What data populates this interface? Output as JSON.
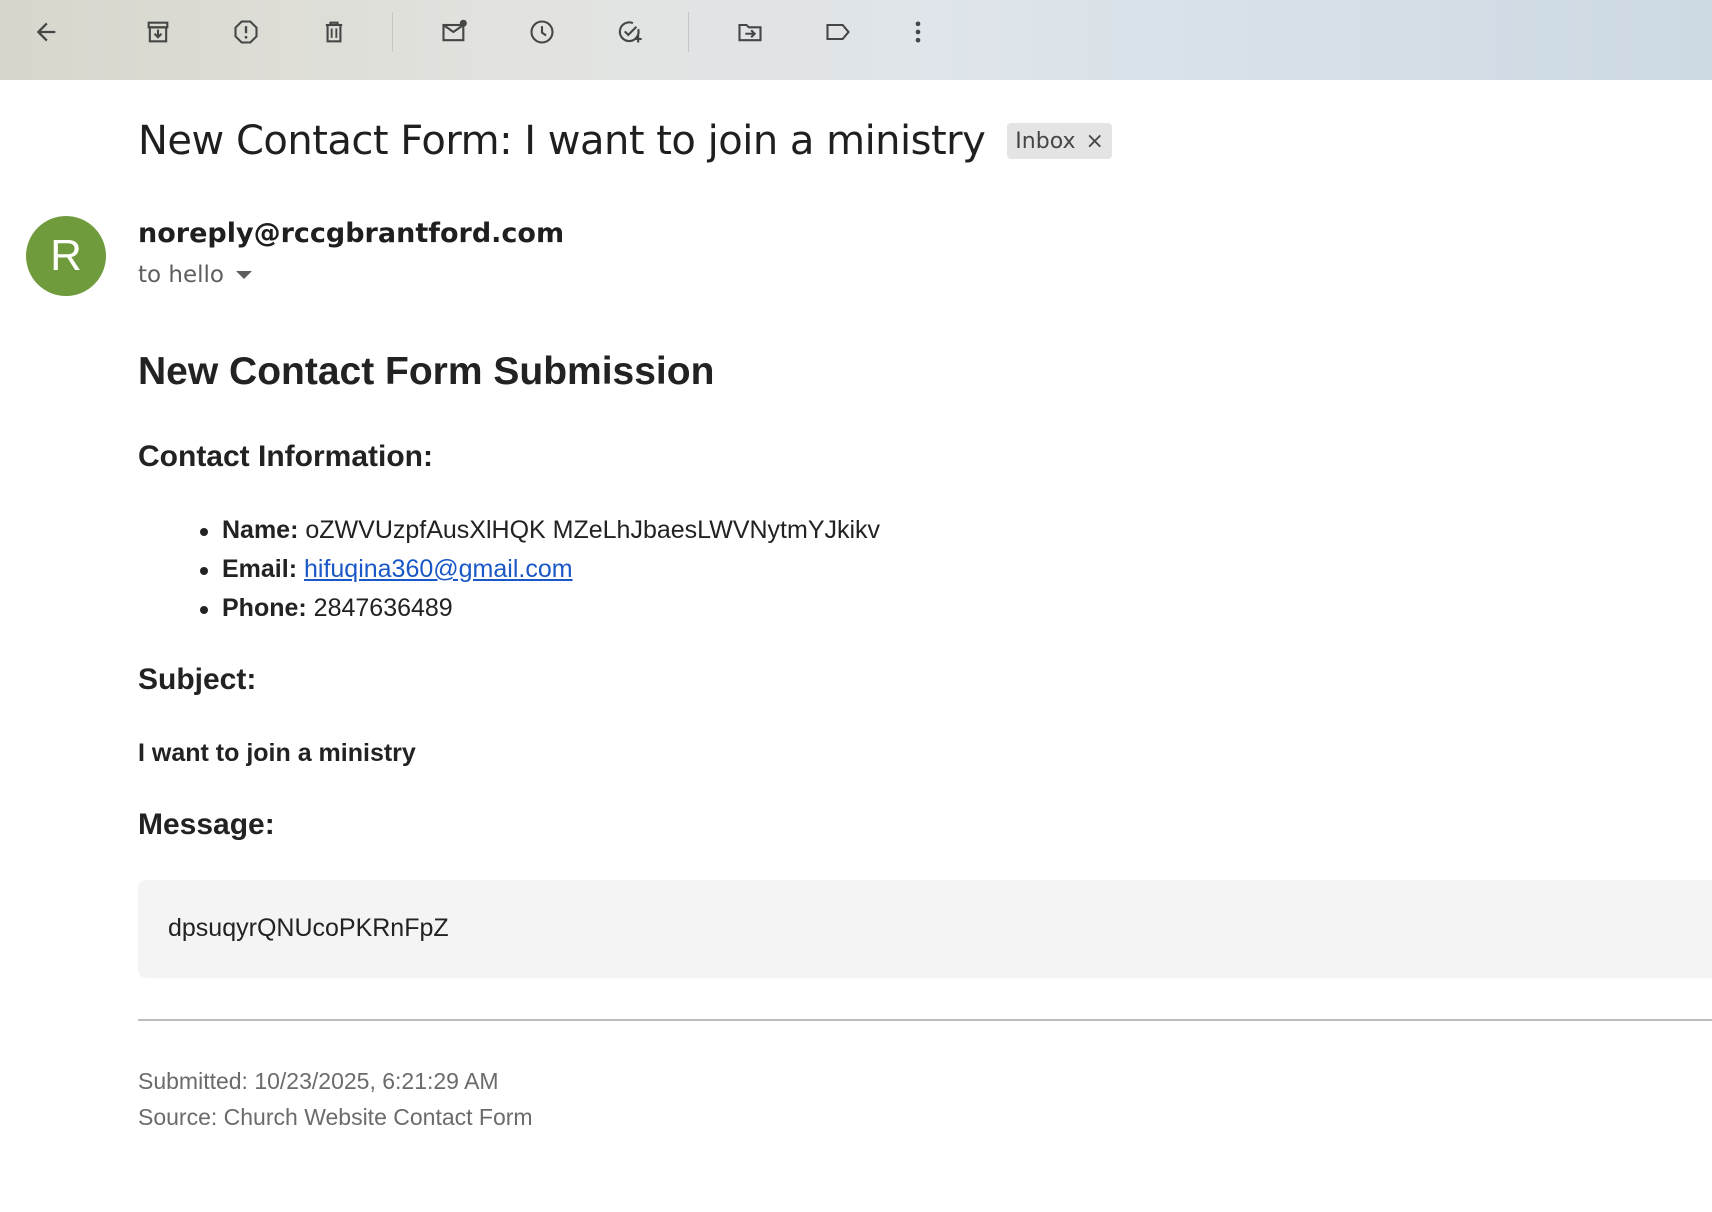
{
  "toolbar": {
    "icons": [
      "back-arrow-icon",
      "archive-icon",
      "report-spam-icon",
      "delete-icon",
      "mark-unread-icon",
      "snooze-icon",
      "add-to-tasks-icon",
      "move-to-icon",
      "label-icon",
      "more-vert-icon"
    ]
  },
  "email": {
    "subject": "New Contact Form: I want to join a ministry",
    "label_chip": "Inbox",
    "label_chip_remove": "×",
    "avatar_letter": "R",
    "avatar_color": "#6f9b3c",
    "sender": "noreply@rccgbrantford.com",
    "recipient": "to hello"
  },
  "content": {
    "heading": "New Contact Form Submission",
    "contact_heading": "Contact Information:",
    "name_label": "Name:",
    "name_value": "oZWVUzpfAusXlHQK MZeLhJbaesLWVNytmYJkikv",
    "email_label": "Email:",
    "email_value": "hifuqina360@gmail.com",
    "phone_label": "Phone:",
    "phone_value": "2847636489",
    "subject_heading": "Subject:",
    "subject_value": "I want to join a ministry",
    "message_heading": "Message:",
    "message_value": "dpsuqyrQNUcoPKRnFpZ",
    "submitted": "Submitted: 10/23/2025, 6:21:29 AM",
    "source": "Source: Church Website Contact Form"
  },
  "colors": {
    "link": "#1a57c7",
    "message_bg": "#f4f4f4"
  }
}
